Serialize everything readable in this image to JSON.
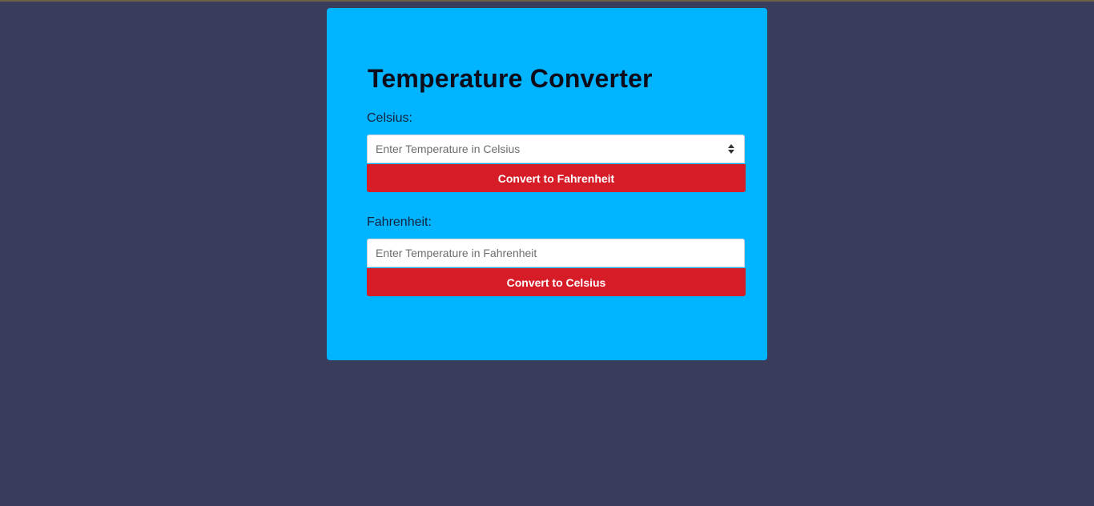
{
  "converter": {
    "title": "Temperature Converter",
    "celsius": {
      "label": "Celsius:",
      "placeholder": "Enter Temperature in Celsius",
      "button_label": "Convert to Fahrenheit"
    },
    "fahrenheit": {
      "label": "Fahrenheit:",
      "placeholder": "Enter Temperature in Fahrenheit",
      "button_label": "Convert to Celsius"
    }
  },
  "colors": {
    "page_background": "#393d5b",
    "card_background": "#00b4ff",
    "button_background": "#d61c27",
    "button_text": "#ffffff"
  },
  "icons": {
    "celsius_spinner": "up-down-spinner-icon"
  }
}
